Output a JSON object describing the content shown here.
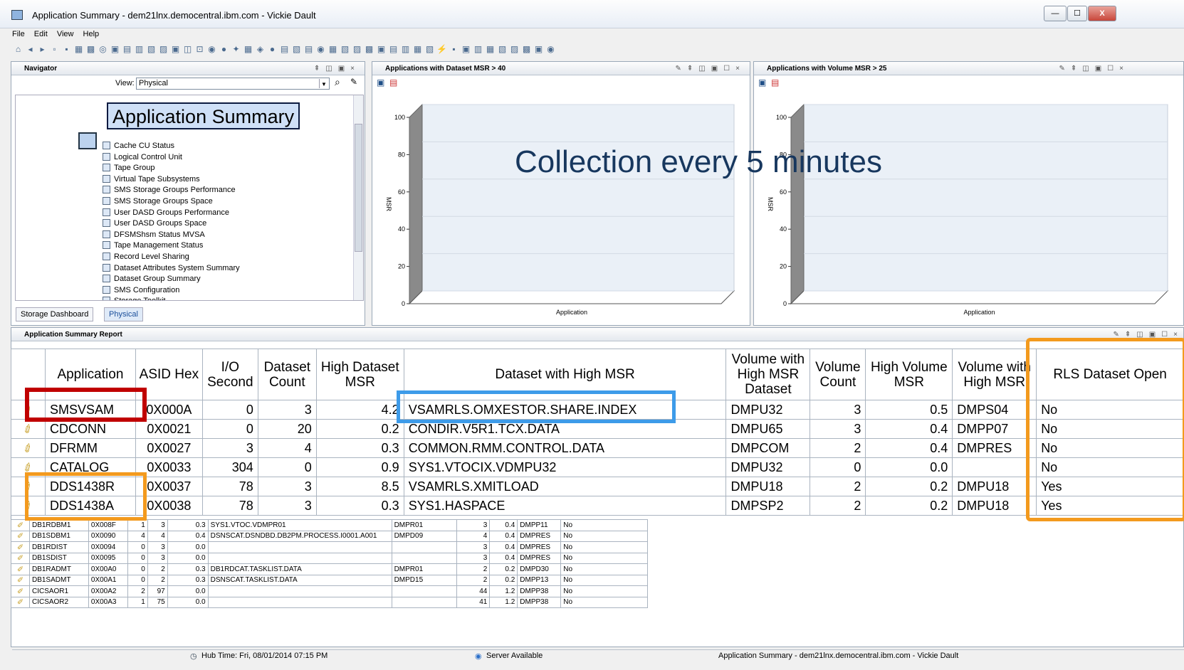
{
  "window": {
    "title": "Application Summary - dem21lnx.democentral.ibm.com - Vickie Dault",
    "min": "—",
    "max": "☐",
    "close": "X"
  },
  "menu": [
    "File",
    "Edit",
    "View",
    "Help"
  ],
  "toolbar_icons": "⌂◂▸▫▪▦▩◎▣▤▥▧▨▣◫⊡◉●✦▦◈●▤▧▤◉▦▧▨▩▣▤▥▦▧⚡▪▣▥▦▧▨▩▣◉",
  "navigator": {
    "title": "Navigator",
    "view_label": "View:",
    "view_value": "Physical",
    "selected": "Application Summary",
    "items": [
      "Cache CU Status",
      "Logical Control Unit",
      "Tape Group",
      "Virtual Tape Subsystems",
      "SMS Storage Groups Performance",
      "SMS Storage Groups Space",
      "User DASD Groups Performance",
      "User DASD Groups Space",
      "DFSMShsm Status MVSA",
      "Tape Management Status",
      "Record Level Sharing",
      "Dataset Attributes System Summary",
      "Dataset Group Summary",
      "SMS Configuration",
      "Storage Toolkit"
    ],
    "tabs": [
      "Storage Dashboard",
      "Physical"
    ]
  },
  "charts": [
    {
      "title": "Applications with Dataset MSR > 40",
      "ylabel": "MSR",
      "xlabel": "Application"
    },
    {
      "title": "Applications with Volume MSR > 25",
      "ylabel": "MSR",
      "xlabel": "Application"
    }
  ],
  "chart_data": [
    {
      "type": "bar",
      "title": "Applications with Dataset MSR > 40",
      "xlabel": "Application",
      "ylabel": "MSR",
      "ylim": [
        0,
        100
      ],
      "yticks": [
        0,
        20,
        40,
        60,
        80,
        100
      ],
      "categories": [],
      "values": []
    },
    {
      "type": "bar",
      "title": "Applications with Volume MSR > 25",
      "xlabel": "Application",
      "ylabel": "MSR",
      "ylim": [
        0,
        100
      ],
      "yticks": [
        0,
        20,
        40,
        60,
        80,
        100
      ],
      "categories": [],
      "values": []
    }
  ],
  "overlay_text": "Collection every 5 minutes",
  "report": {
    "title": "Application Summary Report",
    "headers": [
      "Application",
      "ASID Hex",
      "I/O Second",
      "Dataset Count",
      "High Dataset MSR",
      "Dataset with High MSR",
      "Volume with High MSR Dataset",
      "Volume Count",
      "High Volume MSR",
      "Volume with High MSR",
      "RLS Dataset Open"
    ],
    "rows": [
      [
        "SMSVSAM",
        "0X000A",
        "0",
        "3",
        "4.2",
        "VSAMRLS.OMXESTOR.SHARE.INDEX",
        "DMPU32",
        "3",
        "0.5",
        "DMPS04",
        "No"
      ],
      [
        "CDCONN",
        "0X0021",
        "0",
        "20",
        "0.2",
        "CONDIR.V5R1.TCX.DATA",
        "DMPU65",
        "3",
        "0.4",
        "DMPP07",
        "No"
      ],
      [
        "DFRMM",
        "0X0027",
        "3",
        "4",
        "0.3",
        "COMMON.RMM.CONTROL.DATA",
        "DMPCOM",
        "2",
        "0.4",
        "DMPRES",
        "No"
      ],
      [
        "CATALOG",
        "0X0033",
        "304",
        "0",
        "0.9",
        "SYS1.VTOCIX.VDMPU32",
        "DMPU32",
        "0",
        "0.0",
        "",
        "No"
      ],
      [
        "DDS1438R",
        "0X0037",
        "78",
        "3",
        "8.5",
        "VSAMRLS.XMITLOAD",
        "DMPU18",
        "2",
        "0.2",
        "DMPU18",
        "Yes"
      ],
      [
        "DDS1438A",
        "0X0038",
        "78",
        "3",
        "0.3",
        "SYS1.HASPACE",
        "DMPSP2",
        "2",
        "0.2",
        "DMPU18",
        "Yes"
      ]
    ],
    "small_rows": [
      [
        "DB1RDBM1",
        "0X008F",
        "1",
        "3",
        "0.3",
        "SYS1.VTOC.VDMPR01",
        "DMPR01",
        "3",
        "0.4",
        "DMPP11",
        "No"
      ],
      [
        "DB1SDBM1",
        "0X0090",
        "4",
        "4",
        "0.4",
        "DSNSCAT.DSNDBD.DB2PM.PROCESS.I0001.A001",
        "DMPD09",
        "4",
        "0.4",
        "DMPRES",
        "No"
      ],
      [
        "DB1RDIST",
        "0X0094",
        "0",
        "3",
        "0.0",
        "",
        "",
        "3",
        "0.4",
        "DMPRES",
        "No"
      ],
      [
        "DB1SDIST",
        "0X0095",
        "0",
        "3",
        "0.0",
        "",
        "",
        "3",
        "0.4",
        "DMPRES",
        "No"
      ],
      [
        "DB1RADMT",
        "0X00A0",
        "0",
        "2",
        "0.3",
        "DB1RDCAT.TASKLIST.DATA",
        "DMPR01",
        "2",
        "0.2",
        "DMPD30",
        "No"
      ],
      [
        "DB1SADMT",
        "0X00A1",
        "0",
        "2",
        "0.3",
        "DSNSCAT.TASKLIST.DATA",
        "DMPD15",
        "2",
        "0.2",
        "DMPP13",
        "No"
      ],
      [
        "CICSAOR1",
        "0X00A2",
        "2",
        "97",
        "0.0",
        "",
        "",
        "44",
        "1.2",
        "DMPP38",
        "No"
      ],
      [
        "CICSAOR2",
        "0X00A3",
        "1",
        "75",
        "0.0",
        "",
        "",
        "41",
        "1.2",
        "DMPP38",
        "No"
      ]
    ]
  },
  "status": {
    "hub_time": "Hub Time: Fri, 08/01/2014 07:15 PM",
    "server": "Server Available",
    "right": "Application Summary - dem21lnx.democentral.ibm.com - Vickie Dault"
  },
  "colors": {
    "red_box": "#c00000",
    "blue_box": "#3d9be9",
    "orange_box": "#f39a1e",
    "overlay_text": "#17375e"
  }
}
